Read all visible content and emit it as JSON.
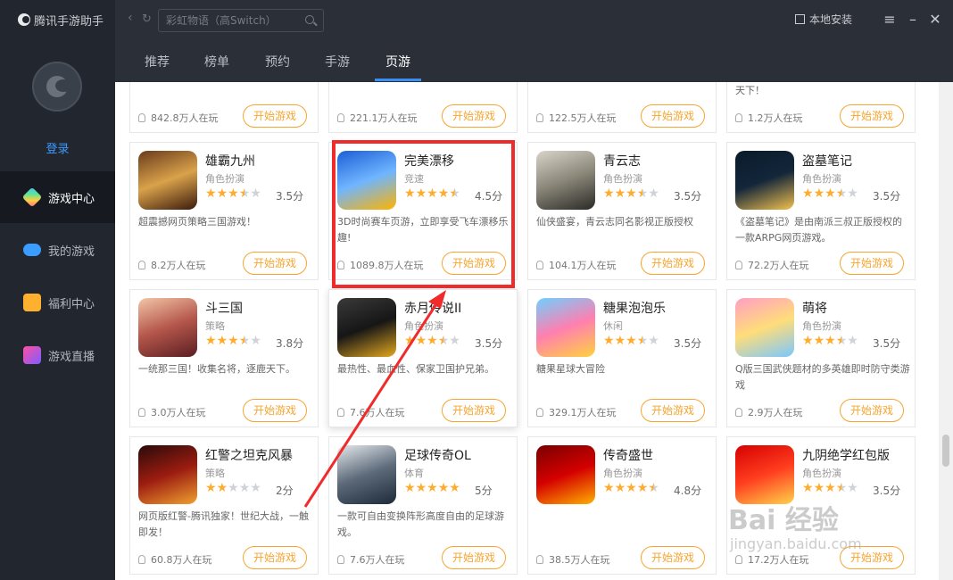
{
  "app": {
    "title": "腾讯手游助手"
  },
  "sidebar": {
    "login_label": "登录",
    "items": [
      {
        "label": "游戏中心",
        "icon": "game-center-icon"
      },
      {
        "label": "我的游戏",
        "icon": "gamepad-icon"
      },
      {
        "label": "福利中心",
        "icon": "gift-icon"
      },
      {
        "label": "游戏直播",
        "icon": "live-icon"
      }
    ]
  },
  "topbar": {
    "search_placeholder": "彩虹物语（高Switch）",
    "local_install_label": "本地安装"
  },
  "tabs": [
    {
      "label": "推荐"
    },
    {
      "label": "榜单"
    },
    {
      "label": "预约"
    },
    {
      "label": "手游"
    },
    {
      "label": "页游"
    }
  ],
  "cards_top_partial": [
    {
      "players": "842.8万人在玩",
      "play_label": "开始游戏"
    },
    {
      "players": "221.1万人在玩",
      "play_label": "开始游戏"
    },
    {
      "players": "122.5万人在玩",
      "play_label": "开始游戏"
    },
    {
      "desc": "天下！",
      "players": "1.2万人在玩",
      "play_label": "开始游戏"
    }
  ],
  "games": [
    {
      "title": "雄霸九州",
      "genre": "角色扮演",
      "score": "3.5分",
      "rating": 3.5,
      "desc": "超震撼网页策略三国游戏！",
      "players": "8.2万人在玩",
      "play_label": "开始游戏"
    },
    {
      "title": "完美漂移",
      "genre": "竞速",
      "score": "4.5分",
      "rating": 4.5,
      "desc": "3D时尚赛车页游，立即享受飞车漂移乐趣!",
      "players": "1089.8万人在玩",
      "play_label": "开始游戏"
    },
    {
      "title": "青云志",
      "genre": "角色扮演",
      "score": "3.5分",
      "rating": 3.5,
      "desc": "仙侠盛宴，青云志同名影视正版授权",
      "players": "104.1万人在玩",
      "play_label": "开始游戏"
    },
    {
      "title": "盗墓笔记",
      "genre": "角色扮演",
      "score": "3.5分",
      "rating": 3.5,
      "desc": "《盗墓笔记》是由南派三叔正版授权的一款ARPG网页游戏。",
      "players": "72.2万人在玩",
      "play_label": "开始游戏"
    },
    {
      "title": "斗三国",
      "genre": "策略",
      "score": "3.8分",
      "rating": 3.8,
      "desc": "一统那三国！收集名将，逐鹿天下。",
      "players": "3.0万人在玩",
      "play_label": "开始游戏"
    },
    {
      "title": "赤月传说II",
      "genre": "角色扮演",
      "score": "3.5分",
      "rating": 3.5,
      "desc": "最热性、最血性、保家卫国护兄弟。",
      "players": "7.6万人在玩",
      "play_label": "开始游戏"
    },
    {
      "title": "糖果泡泡乐",
      "genre": "休闲",
      "score": "3.5分",
      "rating": 3.5,
      "desc": "糖果星球大冒险",
      "players": "329.1万人在玩",
      "play_label": "开始游戏"
    },
    {
      "title": "萌将",
      "genre": "角色扮演",
      "score": "3.5分",
      "rating": 3.5,
      "desc": "Q版三国武侠题材的多英雄即时防守类游戏",
      "players": "2.9万人在玩",
      "play_label": "开始游戏"
    },
    {
      "title": "红警之坦克风暴",
      "genre": "策略",
      "score": "2分",
      "rating": 2,
      "desc": "网页版红警-腾讯独家！世纪大战，一触即发！",
      "players": "60.8万人在玩",
      "play_label": "开始游戏"
    },
    {
      "title": "足球传奇OL",
      "genre": "体育",
      "score": "5分",
      "rating": 5,
      "desc": "一款可自由变换阵形高度自由的足球游戏。",
      "players": "7.6万人在玩",
      "play_label": "开始游戏"
    },
    {
      "title": "传奇盛世",
      "genre": "角色扮演",
      "score": "4.8分",
      "rating": 4.8,
      "desc": "",
      "players": "38.5万人在玩",
      "play_label": "开始游戏"
    },
    {
      "title": "九阴绝学红包版",
      "genre": "角色扮演",
      "score": "3.5分",
      "rating": 3.5,
      "desc": "",
      "players": "17.2万人在玩",
      "play_label": "开始游戏"
    }
  ],
  "watermark": {
    "text": "Bai 经验",
    "url_text": "jingyan.baidu.com"
  },
  "colors": {
    "accent": "#3b8ef3",
    "play_button": "#f7a530",
    "star": "#ffab2e",
    "highlight": "#f02b2b"
  }
}
